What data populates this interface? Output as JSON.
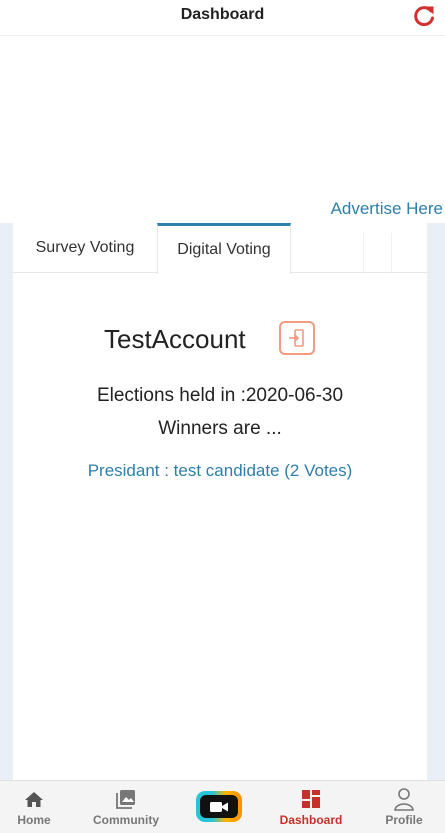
{
  "header": {
    "title": "Dashboard",
    "refresh_icon": "refresh-icon"
  },
  "ad": {
    "label": "Advertise Here"
  },
  "tabs": [
    {
      "label": "Survey Voting",
      "active": false
    },
    {
      "label": "Digital Voting",
      "active": true
    }
  ],
  "account": {
    "name": "TestAccount",
    "logout_icon": "logout-icon"
  },
  "election": {
    "held_text": "Elections held in :2020-06-30",
    "winners_text": "Winners are ...",
    "winner_line": "Presidant : test candidate (2 Votes)"
  },
  "bottom_nav": {
    "items": [
      {
        "label": "Home",
        "icon": "home-icon"
      },
      {
        "label": "Community",
        "icon": "image-icon"
      },
      {
        "label": "",
        "icon": "video-camera-icon"
      },
      {
        "label": "Dashboard",
        "icon": "dashboard-icon",
        "active": true
      },
      {
        "label": "Profile",
        "icon": "person-icon"
      }
    ]
  },
  "colors": {
    "accent": "#2e7fa8",
    "active_nav": "#c6302b",
    "refresh": "#d32f2f",
    "logout_border": "#f29a82",
    "background": "#eaeef5"
  }
}
